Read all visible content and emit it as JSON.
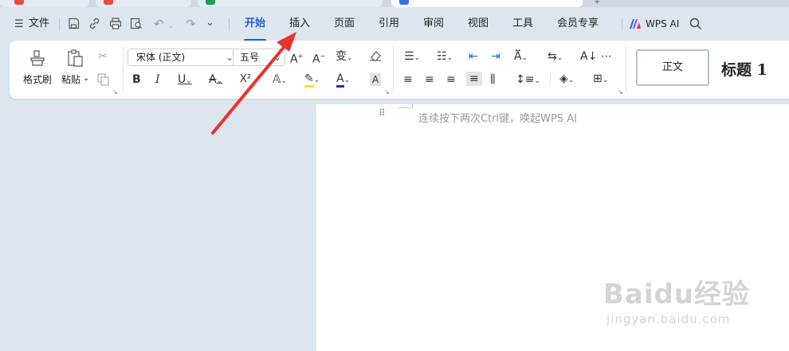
{
  "menu": {
    "file": "文件",
    "tabs": [
      {
        "label": "开始",
        "active": true
      },
      {
        "label": "插入"
      },
      {
        "label": "页面"
      },
      {
        "label": "引用"
      },
      {
        "label": "审阅"
      },
      {
        "label": "视图"
      },
      {
        "label": "工具"
      },
      {
        "label": "会员专享"
      }
    ],
    "wps_ai": "WPS AI"
  },
  "ribbon": {
    "format_painter": "格式刷",
    "paste": "粘贴",
    "font_name": "宋体 (正文)",
    "font_size": "五号",
    "superscript": "X²",
    "styles": {
      "normal": "正文",
      "heading1": "标题 1"
    }
  },
  "document": {
    "placeholder": "连续按下两次Ctrl键，唤起WPS AI"
  },
  "watermark": {
    "logo": "Baidu经验",
    "sub": "jingyan.baidu.com"
  },
  "colors": {
    "accent": "#1f5fd6",
    "arrow": "#e8332a",
    "background": "#dde6ef"
  }
}
